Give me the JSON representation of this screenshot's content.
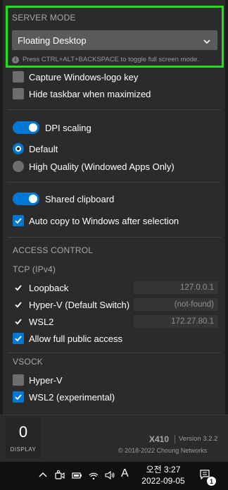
{
  "server_mode": {
    "label": "SERVER MODE",
    "selected": "Floating Desktop",
    "hint": "Press CTRL+ALT+BACKSPACE to toggle full screen mode."
  },
  "options": {
    "capture_windows_key": {
      "label": "Capture Windows-logo key",
      "checked": false
    },
    "hide_taskbar": {
      "label": "Hide taskbar when maximized",
      "checked": false
    },
    "dpi_scaling": {
      "label": "DPI scaling",
      "on": true
    },
    "quality_default": {
      "label": "Default",
      "selected": true
    },
    "quality_high": {
      "label": "High Quality (Windowed Apps Only)",
      "selected": false
    },
    "shared_clipboard": {
      "label": "Shared clipboard",
      "on": true
    },
    "auto_copy": {
      "label": "Auto copy to Windows after selection",
      "checked": true
    }
  },
  "access_control": {
    "label": "ACCESS CONTROL",
    "tcp_label": "TCP (IPv4)",
    "tcp": [
      {
        "label": "Loopback",
        "checked": true,
        "ip": "127.0.0.1"
      },
      {
        "label": "Hyper-V (Default Switch)",
        "checked": true,
        "ip": "(not-found)"
      },
      {
        "label": "WSL2",
        "checked": true,
        "ip": "172.27.80.1"
      }
    ],
    "allow_public": {
      "label": "Allow full public access",
      "checked": true
    },
    "vsock_label": "VSOCK",
    "vsock": [
      {
        "label": "Hyper-V",
        "checked": false
      },
      {
        "label": "WSL2 (experimental)",
        "checked": true
      }
    ]
  },
  "footer": {
    "display_count": "0",
    "display_label": "DISPLAY",
    "brand": "X410",
    "version": "Version 3.2.2",
    "copyright": "© 2018-2022 Choung Networks"
  },
  "taskbar": {
    "ime": "A",
    "time": "오전 3:27",
    "date": "2022-09-05",
    "notification_count": "1"
  },
  "colors": {
    "accent": "#0078d4",
    "highlight_border": "#22e01c",
    "panel": "#2b2b2b"
  }
}
